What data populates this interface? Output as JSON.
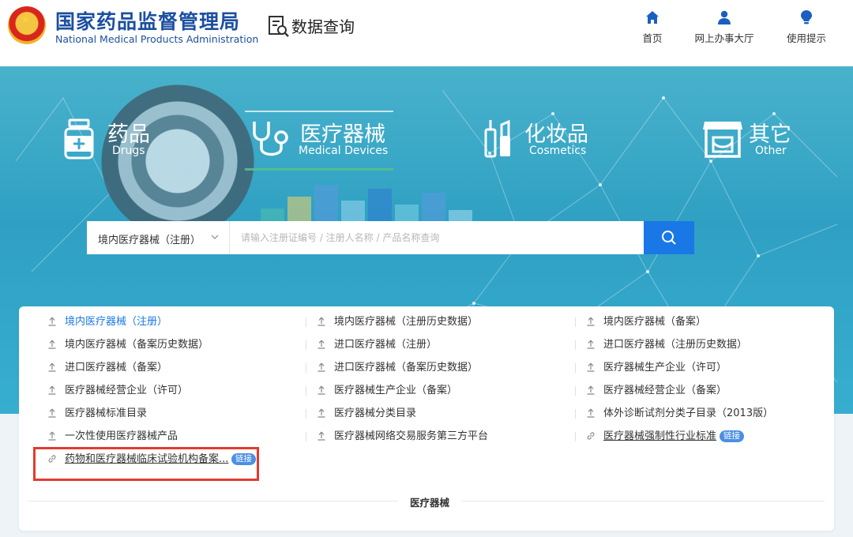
{
  "header": {
    "brand_cn": "国家药品监督管理局",
    "brand_en": "National Medical Products Administration",
    "query_label": "数据查询",
    "nav": [
      {
        "label": "首页",
        "icon": "home-icon"
      },
      {
        "label": "网上办事大厅",
        "icon": "user-icon"
      },
      {
        "label": "使用提示",
        "icon": "lightbulb-icon"
      }
    ]
  },
  "categories": [
    {
      "cn": "药品",
      "en": "Drugs",
      "icon": "medicine-bottle-icon"
    },
    {
      "cn": "医疗器械",
      "en": "Medical Devices",
      "icon": "stethoscope-icon",
      "active": true
    },
    {
      "cn": "化妆品",
      "en": "Cosmetics",
      "icon": "cosmetics-icon"
    },
    {
      "cn": "其它",
      "en": "Other",
      "icon": "shop-icon"
    }
  ],
  "search": {
    "selected": "境内医疗器械（注册）",
    "placeholder": "请输入注册证编号 / 注册人名称 / 产品名称查询"
  },
  "links": {
    "col1": [
      {
        "label": "境内医疗器械（注册）",
        "icon": "upload-icon",
        "active": true
      },
      {
        "label": "境内医疗器械（备案历史数据）",
        "icon": "upload-icon"
      },
      {
        "label": "进口医疗器械（备案）",
        "icon": "upload-icon"
      },
      {
        "label": "医疗器械经营企业（许可）",
        "icon": "upload-icon"
      },
      {
        "label": "医疗器械标准目录",
        "icon": "upload-icon"
      },
      {
        "label": "一次性使用医疗器械产品",
        "icon": "upload-icon"
      },
      {
        "label": "药物和医疗器械临床试验机构备案...",
        "icon": "link-icon",
        "badge": "链接"
      }
    ],
    "col2": [
      {
        "label": "境内医疗器械（注册历史数据）",
        "icon": "upload-icon"
      },
      {
        "label": "进口医疗器械（注册）",
        "icon": "upload-icon"
      },
      {
        "label": "进口医疗器械（备案历史数据）",
        "icon": "upload-icon"
      },
      {
        "label": "医疗器械生产企业（备案）",
        "icon": "upload-icon"
      },
      {
        "label": "医疗器械分类目录",
        "icon": "upload-icon"
      },
      {
        "label": "医疗器械网络交易服务第三方平台",
        "icon": "upload-icon"
      }
    ],
    "col3": [
      {
        "label": "境内医疗器械（备案）",
        "icon": "upload-icon"
      },
      {
        "label": "进口医疗器械（注册历史数据）",
        "icon": "upload-icon"
      },
      {
        "label": "医疗器械生产企业（许可）",
        "icon": "upload-icon"
      },
      {
        "label": "医疗器械经营企业（备案）",
        "icon": "upload-icon"
      },
      {
        "label": "体外诊断试剂分类子目录（2013版）",
        "icon": "upload-icon"
      },
      {
        "label": "医疗器械强制性行业标准",
        "icon": "link-icon",
        "badge": "链接"
      }
    ]
  },
  "panel_footer": "医疗器械",
  "colors": {
    "brand_blue": "#1c4fa0",
    "accent_blue": "#1a78e6",
    "highlight_red": "#e23b2e",
    "hero_teal": "#2fa0c3"
  }
}
